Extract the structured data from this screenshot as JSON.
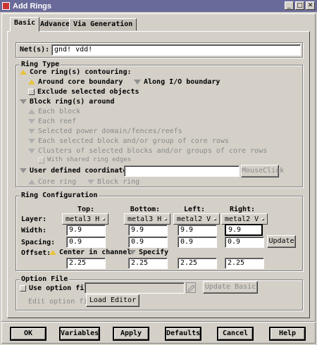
{
  "window": {
    "title": "Add Rings",
    "min": "_",
    "max": "□",
    "close": "✕"
  },
  "tabs": [
    {
      "label": "Basic"
    },
    {
      "label": "Advanced"
    },
    {
      "label": "Via Generation"
    }
  ],
  "nets": {
    "label": "Net(s):",
    "value": "gnd! vdd!"
  },
  "ring_type": {
    "title": "Ring Type",
    "core_ring": "Core ring(s) contouring:",
    "around_core": "Around core boundary",
    "along_io": "Along I/O boundary",
    "exclude_selected": "Exclude selected objects",
    "block_ring": "Block ring(s) around",
    "each_block": "Each block",
    "each_reef": "Each reef",
    "selected_power_domain": "Selected power domain/fences/reefs",
    "each_selected_block": "Each selected block and/or group of core rows",
    "clusters": "Clusters of selected blocks and/or groups of core rows",
    "with_shared": "With shared ring edges",
    "user_defined": "User defined coordinates",
    "user_defined_value": "",
    "mouse_click": "MouseClick",
    "core_ring_opt": "Core ring",
    "block_ring_opt": "Block ring"
  },
  "ring_config": {
    "title": "Ring Configuration",
    "headers": {
      "top": "Top:",
      "bottom": "Bottom:",
      "left": "Left:",
      "right": "Right:"
    },
    "layer_label": "Layer:",
    "layers": {
      "top": "metal3 H",
      "bottom": "metal3 H",
      "left": "metal2 V",
      "right": "metal2 V"
    },
    "width_label": "Width:",
    "widths": {
      "top": "9.9",
      "bottom": "9.9",
      "left": "9.9",
      "right": "9.9"
    },
    "spacing_label": "Spacing:",
    "spacings": {
      "top": "0.9",
      "bottom": "0.9",
      "left": "0.9",
      "right": "0.9"
    },
    "update": "Update",
    "offset_label": "Offset:",
    "center_in_channel": "Center in channel",
    "specify": "Specify",
    "offsets": {
      "top": "2.25",
      "bottom": "2.25",
      "left": "2.25",
      "right": "2.25"
    }
  },
  "option_file": {
    "title": "Option File",
    "use_option_file": "Use option file:",
    "value": "",
    "update_basic": "Update Basic",
    "edit_option_file": "Edit option file",
    "load_editor": "Load Editor"
  },
  "footer": {
    "ok": "OK",
    "variables": "Variables",
    "apply": "Apply",
    "defaults": "Defaults",
    "cancel": "Cancel",
    "help": "Help"
  }
}
